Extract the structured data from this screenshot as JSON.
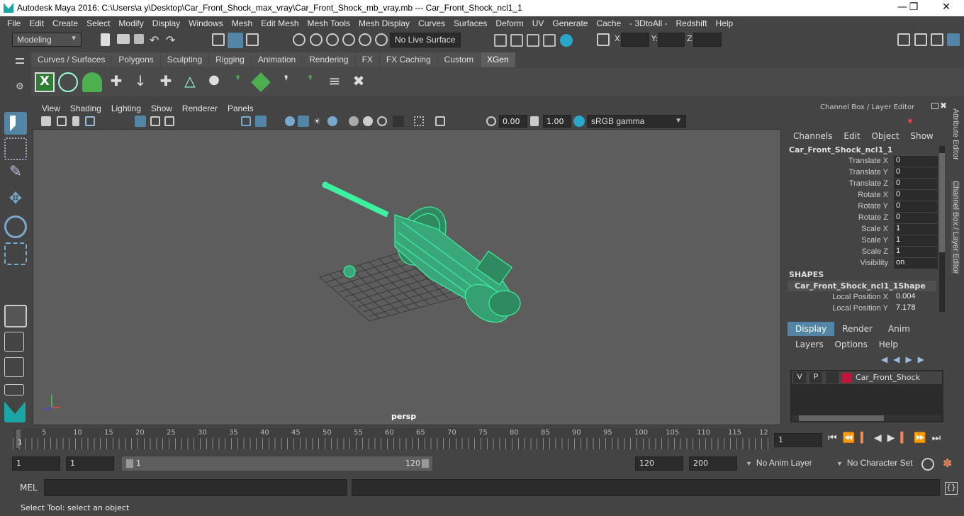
{
  "title": "Autodesk Maya 2016: C:\\Users\\a y\\Desktop\\Car_Front_Shock_max_vray\\Car_Front_Shock_mb_vray.mb   ---   Car_Front_Shock_ncl1_1",
  "menu": [
    "File",
    "Edit",
    "Create",
    "Select",
    "Modify",
    "Display",
    "Windows",
    "Mesh",
    "Edit Mesh",
    "Mesh Tools",
    "Mesh Display",
    "Curves",
    "Surfaces",
    "Deform",
    "UV",
    "Generate",
    "Cache",
    "- 3DtoAll -",
    "Redshift",
    "Help"
  ],
  "status": {
    "mode": "Modeling",
    "live_surface": "No Live Surface",
    "x_label": "X:",
    "y_label": "Y:",
    "z_label": "Z:"
  },
  "shelf_tabs": [
    "Curves / Surfaces",
    "Polygons",
    "Sculpting",
    "Rigging",
    "Animation",
    "Rendering",
    "FX",
    "FX Caching",
    "Custom",
    "XGen"
  ],
  "active_shelf_tab": "XGen",
  "viewport_menu": [
    "View",
    "Shading",
    "Lighting",
    "Show",
    "Renderer",
    "Panels"
  ],
  "viewport": {
    "exposure": "0.00",
    "gamma": "1.00",
    "color_space": "sRGB gamma",
    "camera": "persp"
  },
  "channel_box": {
    "header": "Channel Box / Layer Editor",
    "menu": [
      "Channels",
      "Edit",
      "Object",
      "Show"
    ],
    "object": "Car_Front_Shock_ncl1_1",
    "attrs": [
      {
        "label": "Translate X",
        "value": "0"
      },
      {
        "label": "Translate Y",
        "value": "0"
      },
      {
        "label": "Translate Z",
        "value": "0"
      },
      {
        "label": "Rotate X",
        "value": "0"
      },
      {
        "label": "Rotate Y",
        "value": "0"
      },
      {
        "label": "Rotate Z",
        "value": "0"
      },
      {
        "label": "Scale X",
        "value": "1"
      },
      {
        "label": "Scale Y",
        "value": "1"
      },
      {
        "label": "Scale Z",
        "value": "1"
      },
      {
        "label": "Visibility",
        "value": "on"
      }
    ],
    "shapes_label": "SHAPES",
    "shape": "Car_Front_Shock_ncl1_1Shape",
    "shape_attrs": [
      {
        "label": "Local Position X",
        "value": "0.004"
      },
      {
        "label": "Local Position Y",
        "value": "7.178"
      }
    ]
  },
  "layer_editor": {
    "tabs": [
      "Display",
      "Render",
      "Anim"
    ],
    "menu": [
      "Layers",
      "Options",
      "Help"
    ],
    "layer": {
      "v": "V",
      "p": "P",
      "name": "Car_Front_Shock",
      "color": "#c0143c"
    }
  },
  "side_tabs": [
    "Attribute Editor",
    "Channel Box / Layer Editor"
  ],
  "timeline": {
    "ticks": [
      "5",
      "10",
      "15",
      "20",
      "25",
      "30",
      "35",
      "40",
      "45",
      "50",
      "55",
      "60",
      "65",
      "70",
      "75",
      "80",
      "85",
      "90",
      "95",
      "100",
      "105",
      "110",
      "115",
      "12"
    ],
    "current": "1",
    "frame_field": "1"
  },
  "range": {
    "start": "1",
    "start2": "1",
    "slider_start": "1",
    "slider_end": "120",
    "end": "120",
    "end2": "200",
    "anim_layer": "No Anim Layer",
    "char_set": "No Character Set"
  },
  "mel": {
    "label": "MEL"
  },
  "help": "Select Tool: select an object",
  "colors": {
    "accent": "#5285a6",
    "wire": "#3cf2a0",
    "bg": "#444444"
  }
}
